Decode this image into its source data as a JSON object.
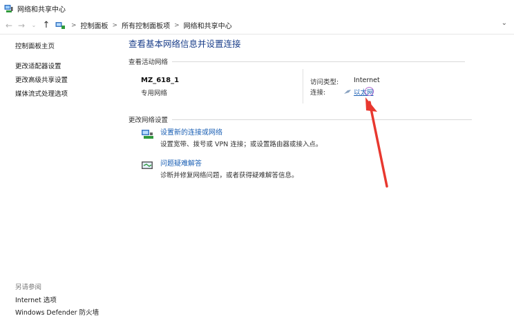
{
  "window": {
    "title": "网络和共享中心"
  },
  "address": {
    "breadcrumbs": [
      "控制面板",
      "所有控制面板项",
      "网络和共享中心"
    ],
    "separator": ">",
    "back_glyph": "←",
    "forward_glyph": "→",
    "up_glyph": "↑",
    "dropdown_glyph": "⌄"
  },
  "sidebar": {
    "items": [
      "控制面板主页",
      "更改适配器设置",
      "更改高级共享设置",
      "媒体流式处理选项"
    ]
  },
  "see_also": {
    "header": "另请参阅",
    "items": [
      "Internet 选项",
      "Windows Defender 防火墙"
    ]
  },
  "main": {
    "title": "查看基本网络信息并设置连接",
    "active_header": "查看活动网络",
    "network_name": "MZ_618_1",
    "network_type": "专用网络",
    "access_type_label": "访问类型:",
    "access_type_value": "Internet",
    "connection_label": "连接:",
    "connection_value": "以太网",
    "change_header": "更改网络设置",
    "tasks": [
      {
        "title": "设置新的连接或网络",
        "desc": "设置宽带、拨号或 VPN 连接；或设置路由器或接入点。",
        "icon": "network-setup-icon"
      },
      {
        "title": "问题疑难解答",
        "desc": "诊断并修复网络问题，或者获得疑难解答信息。",
        "icon": "troubleshoot-icon"
      }
    ]
  },
  "colors": {
    "link": "#1a5fb4",
    "title": "#1a3e8a",
    "annotation_arrow": "#e8382f"
  }
}
